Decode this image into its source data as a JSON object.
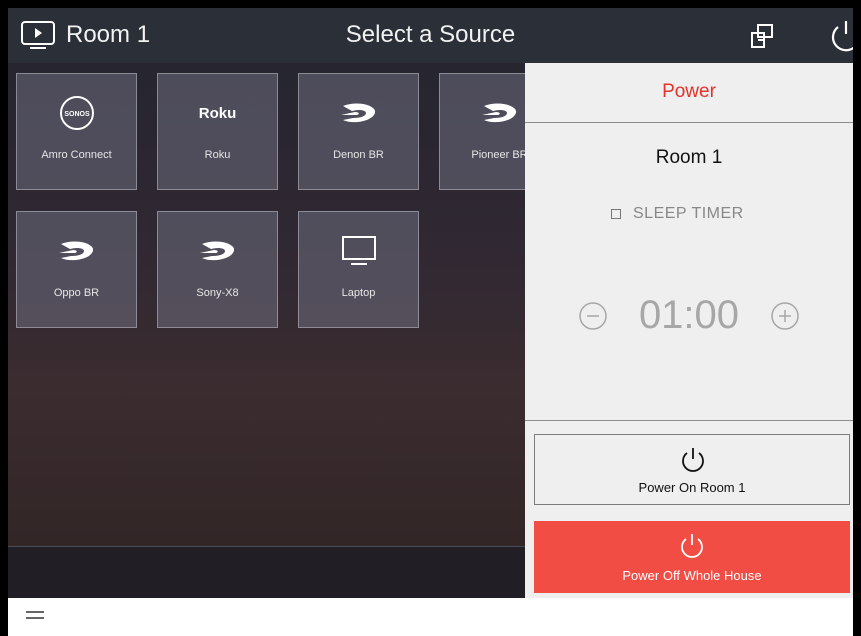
{
  "header": {
    "room": "Room 1",
    "title": "Select a Source",
    "icons": [
      "tv-icon",
      "layout-icon",
      "power-icon"
    ]
  },
  "sources": [
    {
      "label": "Amro Connect",
      "logo_text": "SONOS",
      "icon": "sonos-logo"
    },
    {
      "label": "Roku",
      "logo_text": "Roku",
      "icon": "roku-logo"
    },
    {
      "label": "Denon BR",
      "icon": "bluray-logo"
    },
    {
      "label": "Pioneer BR",
      "icon": "bluray-logo"
    },
    {
      "label": "Oppo BR",
      "icon": "bluray-logo"
    },
    {
      "label": "Sony-X8",
      "icon": "bluray-logo"
    },
    {
      "label": "Laptop",
      "icon": "monitor-icon"
    }
  ],
  "power_panel": {
    "title": "Power",
    "room": "Room 1",
    "sleep_timer_label": "SLEEP TIMER",
    "timer_value": "01:00",
    "power_on_label": "Power On Room 1",
    "power_off_label": "Power Off Whole House",
    "accent_color": "#e4322b",
    "power_off_color": "#f24d45"
  },
  "footer": {
    "icon": "menu-icon"
  }
}
